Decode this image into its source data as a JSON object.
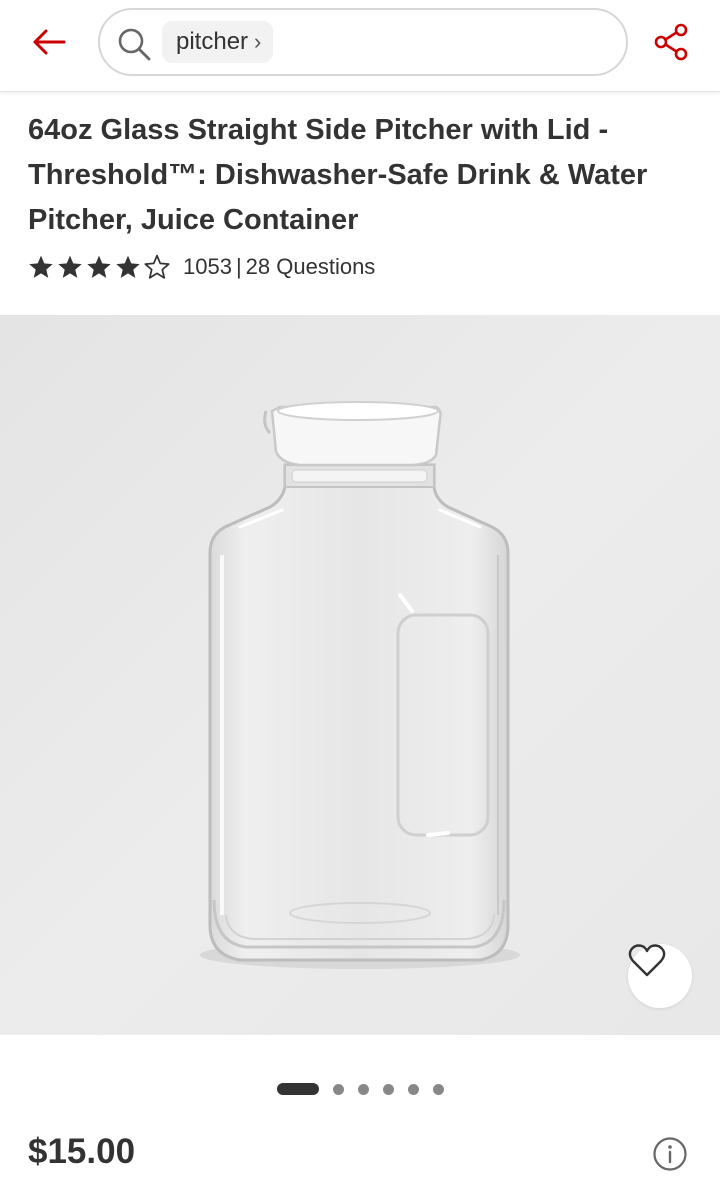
{
  "header": {
    "search_chip": "pitcher",
    "chip_chevron": "›",
    "icons": {
      "back": "arrow-left-icon",
      "search": "search-icon",
      "share": "share-icon"
    },
    "accent_color": "#cc0000"
  },
  "product": {
    "title": "64oz Glass Straight Side Pitcher with Lid - Threshold™: Dishwasher-Safe Drink & Water Pitcher, Juice Container",
    "rating": {
      "stars_filled": 4,
      "stars_total": 5,
      "review_count": "1053",
      "separator": "|",
      "questions": "28 Questions"
    },
    "image": {
      "description_icon": "product-photo",
      "favorite_icon": "heart-outline-icon"
    },
    "carousel": {
      "total": 6,
      "active_index": 0
    },
    "price": "$15.00",
    "info_icon": "info-icon"
  },
  "colors": {
    "text": "#333333",
    "accent": "#cc0000",
    "image_bg": "#e9e9e9"
  }
}
